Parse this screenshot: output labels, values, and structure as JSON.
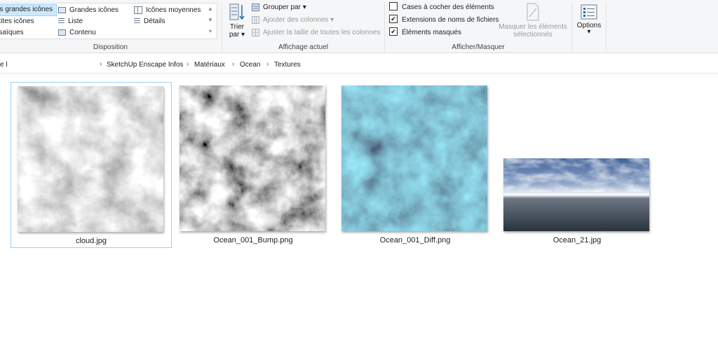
{
  "ribbon": {
    "layout_group": {
      "label": "Disposition",
      "items": [
        "ès grandes icônes",
        "Grandes icônes",
        "Icônes moyennes",
        "etites icônes",
        "Liste",
        "Détails",
        "osaïques",
        "Contenu"
      ],
      "selected_index": 0
    },
    "current_view_group": {
      "label": "Affichage actuel",
      "sort_label_1": "Trier",
      "sort_label_2": "par ▾",
      "group_by": "Grouper par ▾",
      "add_columns": "Ajouter des colonnes ▾",
      "fit_columns": "Ajuster la taille de toutes les colonnes"
    },
    "show_hide_group": {
      "label": "Afficher/Masquer",
      "checkboxes": [
        {
          "label": "Cases à cocher des éléments",
          "checked": false
        },
        {
          "label": "Extensions de noms de fichiers",
          "checked": true
        },
        {
          "label": "Éléments masqués",
          "checked": true
        }
      ],
      "hide_selected_1": "Masquer les éléments",
      "hide_selected_2": "sélectionnés"
    },
    "options": {
      "label": "Options",
      "arrow": "▾"
    }
  },
  "address": {
    "left_stub": "e l",
    "crumbs": [
      "SketchUp Enscape Infos",
      "Matériaux",
      "Ocean",
      "Textures"
    ],
    "separator": "›"
  },
  "files": [
    {
      "name": "cloud.jpg",
      "selected": true,
      "thumb": "cloud"
    },
    {
      "name": "Ocean_001_Bump.png",
      "selected": false,
      "thumb": "bump"
    },
    {
      "name": "Ocean_001_Diff.png",
      "selected": false,
      "thumb": "diff"
    },
    {
      "name": "Ocean_21.jpg",
      "selected": false,
      "thumb": "sky"
    }
  ],
  "colors": {
    "selection_fill": "#cce8ff",
    "selection_border": "#99d1ff",
    "ribbon_bg": "#f5f6f7"
  }
}
